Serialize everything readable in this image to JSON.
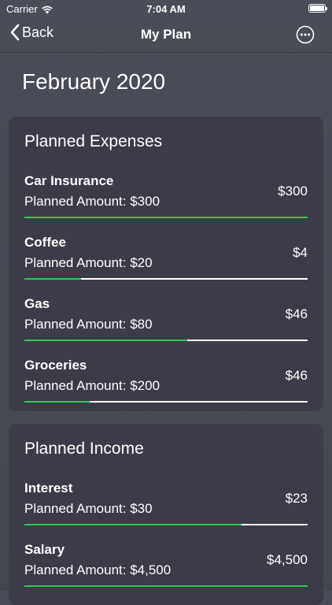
{
  "status_bar": {
    "carrier": "Carrier",
    "time": "7:04 AM"
  },
  "nav": {
    "back_label": "Back",
    "title": "My Plan"
  },
  "month_title": "February 2020",
  "colors": {
    "progress_fill": "#34c759",
    "progress_track": "#ffffff",
    "card_bg": "#3b3c47"
  },
  "expenses": {
    "title": "Planned Expenses",
    "items": [
      {
        "name": "Car Insurance",
        "planned": "Planned Amount: $300",
        "amount": "$300",
        "progress": 1.0
      },
      {
        "name": "Coffee",
        "planned": "Planned Amount: $20",
        "amount": "$4",
        "progress": 0.2
      },
      {
        "name": "Gas",
        "planned": "Planned Amount: $80",
        "amount": "$46",
        "progress": 0.575
      },
      {
        "name": "Groceries",
        "planned": "Planned Amount: $200",
        "amount": "$46",
        "progress": 0.23
      }
    ]
  },
  "income": {
    "title": "Planned Income",
    "items": [
      {
        "name": "Interest",
        "planned": "Planned Amount: $30",
        "amount": "$23",
        "progress": 0.767
      },
      {
        "name": "Salary",
        "planned": "Planned Amount: $4,500",
        "amount": "$4,500",
        "progress": 1.0
      }
    ]
  }
}
